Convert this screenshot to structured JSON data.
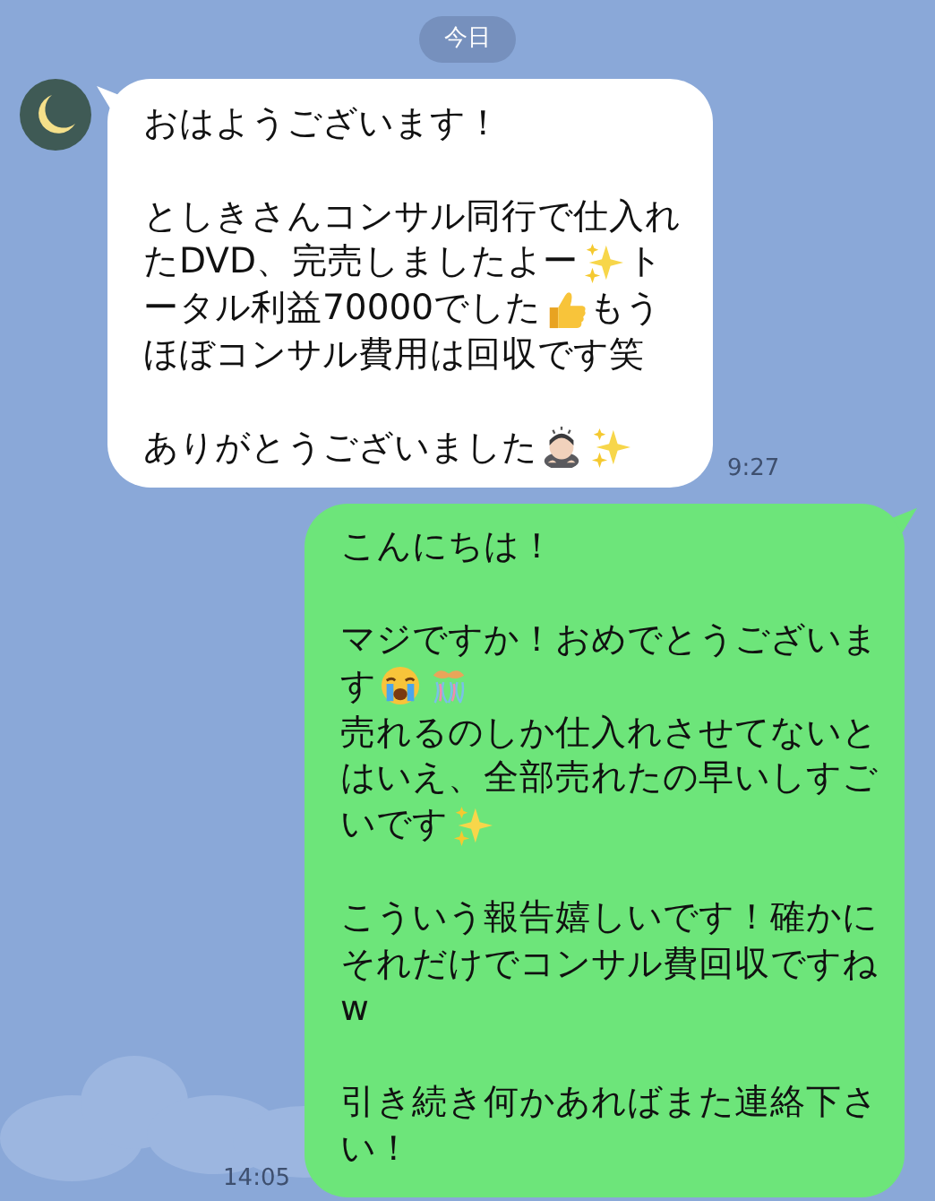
{
  "date_label": "今日",
  "messages": [
    {
      "kind": "incoming",
      "time": "9:27",
      "paragraphs": [
        {
          "lines": [
            [
              {
                "kind": "text",
                "text": "おはようございます！"
              }
            ]
          ]
        },
        {
          "lines": [
            [
              {
                "kind": "text",
                "text": "としきさんコンサル同行で仕入れ"
              }
            ],
            [
              {
                "kind": "text",
                "text": "たDVD、完売しましたよー"
              },
              {
                "kind": "sparkles"
              },
              {
                "kind": "text",
                "text": "ト"
              }
            ],
            [
              {
                "kind": "text",
                "text": "ータル利益70000でした"
              },
              {
                "kind": "thumbs-up"
              },
              {
                "kind": "text",
                "text": "もう"
              }
            ],
            [
              {
                "kind": "text",
                "text": "ほぼコンサル費用は回収です笑"
              }
            ]
          ]
        },
        {
          "lines": [
            [
              {
                "kind": "text",
                "text": "ありがとうございました"
              },
              {
                "kind": "bowing"
              },
              {
                "kind": "sparkles"
              }
            ]
          ]
        }
      ]
    },
    {
      "kind": "outgoing",
      "time": "14:05",
      "paragraphs": [
        {
          "lines": [
            [
              {
                "kind": "text",
                "text": "こんにちは！"
              }
            ]
          ]
        },
        {
          "lines": [
            [
              {
                "kind": "text",
                "text": "マジですか！おめでとうございま"
              }
            ],
            [
              {
                "kind": "text",
                "text": "す"
              },
              {
                "kind": "crying"
              },
              {
                "kind": "confetti"
              }
            ],
            [
              {
                "kind": "text",
                "text": "売れるのしか仕入れさせてないと"
              }
            ],
            [
              {
                "kind": "text",
                "text": "はいえ、全部売れたの早いしすご"
              }
            ],
            [
              {
                "kind": "text",
                "text": "いです"
              },
              {
                "kind": "sparkles"
              }
            ]
          ]
        },
        {
          "lines": [
            [
              {
                "kind": "text",
                "text": "こういう報告嬉しいです！確かに"
              }
            ],
            [
              {
                "kind": "text",
                "text": "それだけでコンサル費回収ですね"
              }
            ],
            [
              {
                "kind": "text",
                "text": "w"
              }
            ]
          ]
        },
        {
          "lines": [
            [
              {
                "kind": "text",
                "text": "引き続き何かあればまた連絡下さ"
              }
            ],
            [
              {
                "kind": "text",
                "text": "い！"
              }
            ]
          ]
        }
      ]
    }
  ]
}
